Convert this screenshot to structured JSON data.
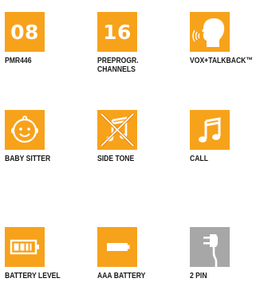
{
  "features": [
    {
      "id": "pmr446",
      "tile_text": "08",
      "caption": [
        "PMR446"
      ],
      "icon": "number-tile"
    },
    {
      "id": "channels",
      "tile_text": "16",
      "caption": [
        "PREPROGR.",
        "CHANNELS"
      ],
      "icon": "number-tile"
    },
    {
      "id": "vox",
      "caption": [
        "VOX+TALKBACK™"
      ],
      "icon": "speaking-head-icon"
    },
    {
      "id": "baby-sitter",
      "caption": [
        "BABY SITTER"
      ],
      "icon": "baby-face-icon"
    },
    {
      "id": "side-tone",
      "caption": [
        "SIDE TONE"
      ],
      "icon": "muted-note-icon"
    },
    {
      "id": "call",
      "caption": [
        "CALL"
      ],
      "icon": "music-note-icon"
    },
    {
      "id": "battery-level",
      "caption": [
        "BATTERY LEVEL"
      ],
      "icon": "battery-level-icon"
    },
    {
      "id": "aaa-battery",
      "caption": [
        "AAA BATTERY"
      ],
      "icon": "battery-icon"
    },
    {
      "id": "2pin",
      "caption": [
        "2 PIN"
      ],
      "icon": "plug-icon"
    }
  ],
  "colors": {
    "tile_orange": "#f7a21b",
    "tile_gray": "#a7a7a7",
    "icon_white": "#ffffff",
    "strike_orange": "#e98b10",
    "caption_text": "#1a1a1a"
  }
}
